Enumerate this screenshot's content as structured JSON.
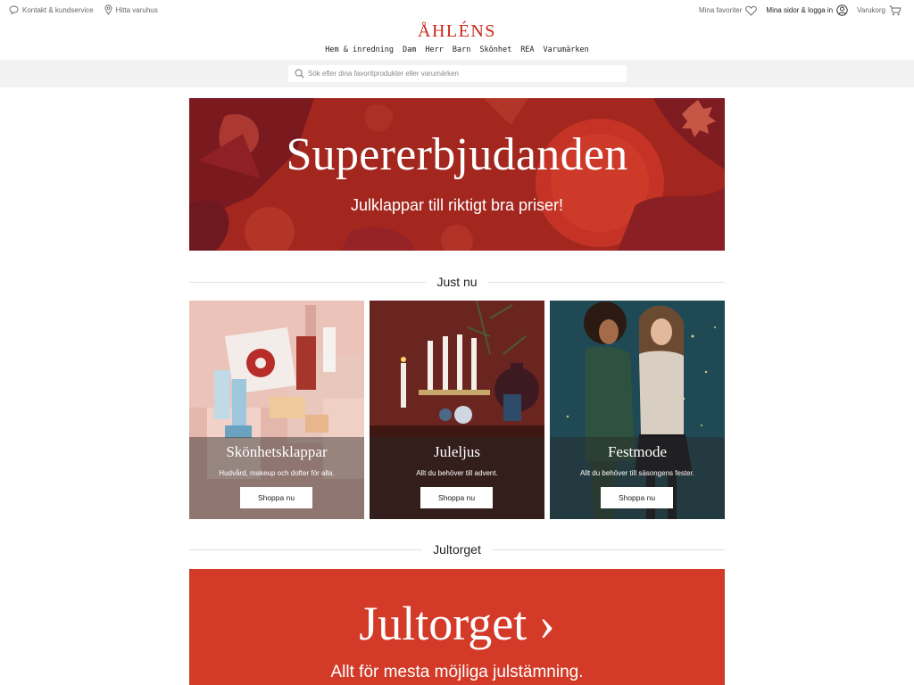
{
  "utility": {
    "contact_label": "Kontakt & kundservice",
    "stores_label": "Hitta varuhus",
    "favorites_label": "Mina favoriter",
    "account_label": "Mina sidor & logga in",
    "cart_label": "Varukorg"
  },
  "brand": {
    "logo_text": "ÅHLÉNS",
    "accent_color": "#c8261b"
  },
  "nav": {
    "items": [
      "Hem & inredning",
      "Dam",
      "Herr",
      "Barn",
      "Skönhet",
      "REA",
      "Varumärken"
    ]
  },
  "search": {
    "placeholder": "Sök efter dina favoritprodukter eller varumärken",
    "value": ""
  },
  "hero": {
    "title": "Supererbjudanden",
    "subtitle": "Julklappar till riktigt bra priser!",
    "bg_color": "#a7261e"
  },
  "sections": {
    "just_nu": "Just nu",
    "jultorget": "Jultorget"
  },
  "cards": [
    {
      "title": "Skönhetsklappar",
      "description": "Hudvård, makeup och dofter för alla.",
      "button": "Shoppa nu"
    },
    {
      "title": "Juleljus",
      "description": "Allt du behöver till advent.",
      "button": "Shoppa nu"
    },
    {
      "title": "Festmode",
      "description": "Allt du behöver till säsongens fester.",
      "button": "Shoppa nu"
    }
  ],
  "jultorget_banner": {
    "title": "Jultorget ›",
    "subtitle": "Allt för mesta möjliga julstämning.",
    "bg_color": "#d33a28"
  }
}
